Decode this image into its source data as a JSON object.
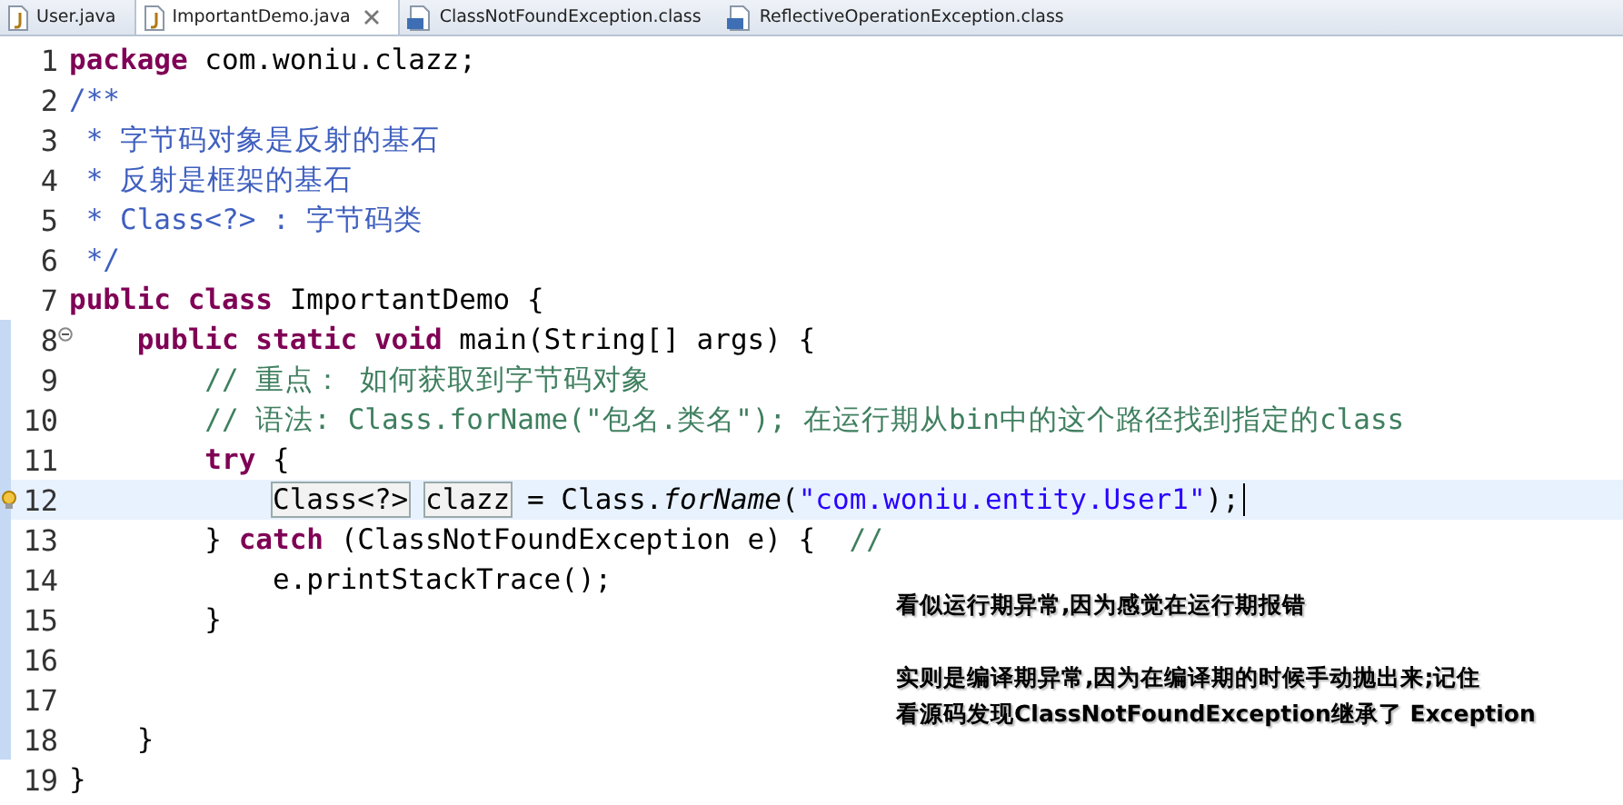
{
  "tabs": [
    {
      "label": "User.java",
      "kind": "java",
      "selected": false
    },
    {
      "label": "ImportantDemo.java",
      "kind": "java",
      "selected": true
    },
    {
      "label": "ClassNotFoundException.class",
      "kind": "class",
      "selected": false
    },
    {
      "label": "ReflectiveOperationException.class",
      "kind": "class",
      "selected": false
    }
  ],
  "editor": {
    "lines": [
      {
        "number": "1",
        "in_range": false,
        "current": false,
        "fold": false,
        "warning": false,
        "tokens": [
          {
            "kind": "keyword",
            "text": "package"
          },
          {
            "kind": "plain",
            "text": " com.woniu.clazz;"
          }
        ]
      },
      {
        "number": "2",
        "in_range": false,
        "current": false,
        "fold": false,
        "warning": false,
        "tokens": [
          {
            "kind": "javadoc",
            "text": "/**"
          }
        ]
      },
      {
        "number": "3",
        "in_range": false,
        "current": false,
        "fold": false,
        "warning": false,
        "tokens": [
          {
            "kind": "javadoc",
            "text": " * 字节码对象是反射的基石"
          }
        ]
      },
      {
        "number": "4",
        "in_range": false,
        "current": false,
        "fold": false,
        "warning": false,
        "tokens": [
          {
            "kind": "javadoc",
            "text": " * 反射是框架的基石"
          }
        ]
      },
      {
        "number": "5",
        "in_range": false,
        "current": false,
        "fold": false,
        "warning": false,
        "tokens": [
          {
            "kind": "javadoc",
            "text": " * Class<?> : 字节码类"
          }
        ]
      },
      {
        "number": "6",
        "in_range": false,
        "current": false,
        "fold": false,
        "warning": false,
        "tokens": [
          {
            "kind": "javadoc",
            "text": " */"
          }
        ]
      },
      {
        "number": "7",
        "in_range": false,
        "current": false,
        "fold": false,
        "warning": false,
        "tokens": [
          {
            "kind": "keyword",
            "text": "public class"
          },
          {
            "kind": "plain",
            "text": " ImportantDemo {"
          }
        ]
      },
      {
        "number": "8",
        "in_range": true,
        "current": false,
        "fold": true,
        "warning": false,
        "tokens": [
          {
            "kind": "keyword",
            "text": "    public static void"
          },
          {
            "kind": "plain",
            "text": " main(String[] args) {"
          }
        ]
      },
      {
        "number": "9",
        "in_range": true,
        "current": false,
        "fold": false,
        "warning": false,
        "tokens": [
          {
            "kind": "comment",
            "text": "        // 重点： 如何获取到字节码对象"
          }
        ]
      },
      {
        "number": "10",
        "in_range": true,
        "current": false,
        "fold": false,
        "warning": false,
        "tokens": [
          {
            "kind": "comment",
            "text": "        // 语法: Class.forName(\"包名.类名\"); 在运行期从bin中的这个路径找到指定的class"
          }
        ]
      },
      {
        "number": "11",
        "in_range": true,
        "current": false,
        "fold": false,
        "warning": false,
        "tokens": [
          {
            "kind": "keyword",
            "text": "        try"
          },
          {
            "kind": "plain",
            "text": " {"
          }
        ]
      },
      {
        "number": "12",
        "in_range": true,
        "current": true,
        "fold": false,
        "warning": true,
        "tokens": [
          {
            "kind": "boxed",
            "text": "            Class<?>"
          },
          {
            "kind": "boxed",
            "text": " clazz"
          },
          {
            "kind": "plain",
            "text": " = Class."
          },
          {
            "kind": "method_italic",
            "text": "forName"
          },
          {
            "kind": "plain",
            "text": "("
          },
          {
            "kind": "string",
            "text": "\"com.woniu.entity.User1\""
          },
          {
            "kind": "plain",
            "text": ");"
          }
        ]
      },
      {
        "number": "13",
        "in_range": true,
        "current": false,
        "fold": false,
        "warning": false,
        "tokens": [
          {
            "kind": "plain",
            "text": "        } "
          },
          {
            "kind": "keyword",
            "text": "catch"
          },
          {
            "kind": "plain",
            "text": " (ClassNotFoundException e) {  "
          },
          {
            "kind": "comment",
            "text": "//"
          }
        ]
      },
      {
        "number": "14",
        "in_range": true,
        "current": false,
        "fold": false,
        "warning": false,
        "tokens": [
          {
            "kind": "plain",
            "text": "            e.printStackTrace();"
          }
        ]
      },
      {
        "number": "15",
        "in_range": true,
        "current": false,
        "fold": false,
        "warning": false,
        "tokens": [
          {
            "kind": "plain",
            "text": "        }"
          }
        ]
      },
      {
        "number": "16",
        "in_range": true,
        "current": false,
        "fold": false,
        "warning": false
      },
      {
        "number": "17",
        "in_range": true,
        "current": false,
        "fold": false,
        "warning": false
      },
      {
        "number": "18",
        "in_range": true,
        "current": false,
        "fold": false,
        "warning": false,
        "tokens": [
          {
            "kind": "plain",
            "text": "    }"
          }
        ]
      },
      {
        "number": "19",
        "in_range": false,
        "current": false,
        "fold": false,
        "warning": false,
        "tokens": [
          {
            "kind": "plain",
            "text": "}"
          }
        ]
      }
    ]
  },
  "annotation": [
    "看似运行期异常,因为感觉在运行期报错",
    "实则是编译期异常,因为在编译期的时候手动抛出来;记住",
    "看源码发现ClassNotFoundException继承了 Exception"
  ]
}
